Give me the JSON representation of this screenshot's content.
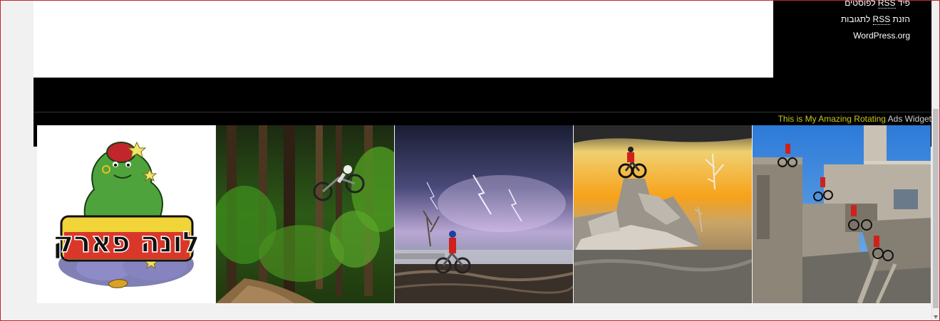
{
  "sidebar": {
    "links": [
      {
        "pre": "פיד ",
        "abbr": "RSS",
        "post": " לפוסטים"
      },
      {
        "pre": "הזנת ",
        "abbr": "RSS",
        "post": " לתגובות"
      },
      {
        "pre": "",
        "abbr": "",
        "post": "WordPress.org"
      }
    ]
  },
  "ads": {
    "title_highlight": "This is My Amazing Rotating",
    "title_rest": " Ads Widget",
    "logo_text": "לונה פארק",
    "items": [
      {
        "icon": "luna-park-logo-image"
      },
      {
        "icon": "forest-bike-jump-image"
      },
      {
        "icon": "storm-bike-rider-image"
      },
      {
        "icon": "ruins-bike-trial-image"
      },
      {
        "icon": "building-bike-trial-image"
      }
    ]
  },
  "colors": {
    "ad_title_highlight": "#c8c81e",
    "frame_border": "#c0262c"
  }
}
